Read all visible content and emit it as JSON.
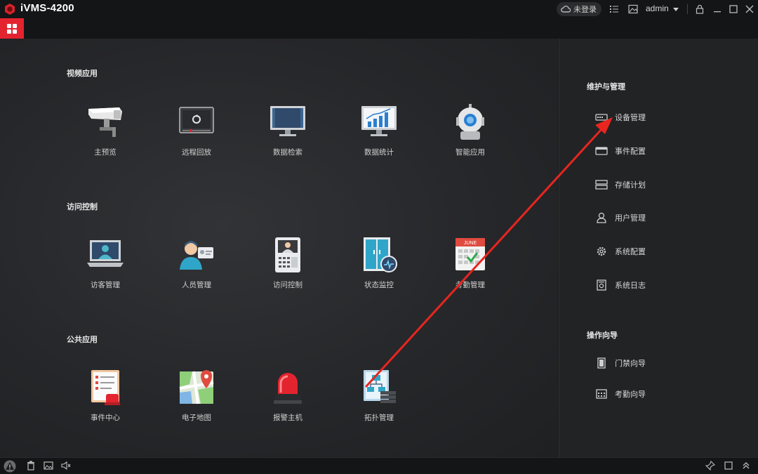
{
  "window": {
    "title": "iVMS-4200",
    "user": "admin",
    "cloud_status": "未登录"
  },
  "sections": {
    "video": {
      "title": "视频应用",
      "apps": [
        {
          "label": "主预览",
          "icon": "camera-icon"
        },
        {
          "label": "远程回放",
          "icon": "playback-icon"
        },
        {
          "label": "数据检索",
          "icon": "monitor-search-icon"
        },
        {
          "label": "数据统计",
          "icon": "statistics-chart-icon"
        },
        {
          "label": "智能应用",
          "icon": "robot-icon"
        }
      ]
    },
    "access": {
      "title": "访问控制",
      "apps": [
        {
          "label": "访客管理",
          "icon": "visitor-laptop-icon"
        },
        {
          "label": "人员管理",
          "icon": "person-card-icon"
        },
        {
          "label": "访问控制",
          "icon": "door-station-icon"
        },
        {
          "label": "状态监控",
          "icon": "door-status-icon"
        },
        {
          "label": "考勤管理",
          "icon": "calendar-attendance-icon",
          "badge": "JUNE"
        }
      ]
    },
    "public": {
      "title": "公共应用",
      "apps": [
        {
          "label": "事件中心",
          "icon": "event-center-icon"
        },
        {
          "label": "电子地图",
          "icon": "map-icon"
        },
        {
          "label": "报警主机",
          "icon": "alarm-light-icon"
        },
        {
          "label": "拓扑管理",
          "icon": "topology-icon"
        }
      ]
    }
  },
  "sidebar": {
    "maintenance": {
      "title": "维护与管理",
      "items": [
        {
          "label": "设备管理",
          "icon": "device-icon"
        },
        {
          "label": "事件配置",
          "icon": "event-config-icon"
        },
        {
          "label": "存储计划",
          "icon": "storage-icon"
        },
        {
          "label": "用户管理",
          "icon": "user-icon"
        },
        {
          "label": "系统配置",
          "icon": "gear-icon"
        },
        {
          "label": "系统日志",
          "icon": "log-icon"
        }
      ]
    },
    "wizard": {
      "title": "操作向导",
      "items": [
        {
          "label": "门禁向导",
          "icon": "door-guide-icon"
        },
        {
          "label": "考勤向导",
          "icon": "attendance-guide-icon"
        }
      ]
    }
  },
  "colors": {
    "accent": "#e3242f",
    "annotation_arrow": "#e8251f"
  }
}
